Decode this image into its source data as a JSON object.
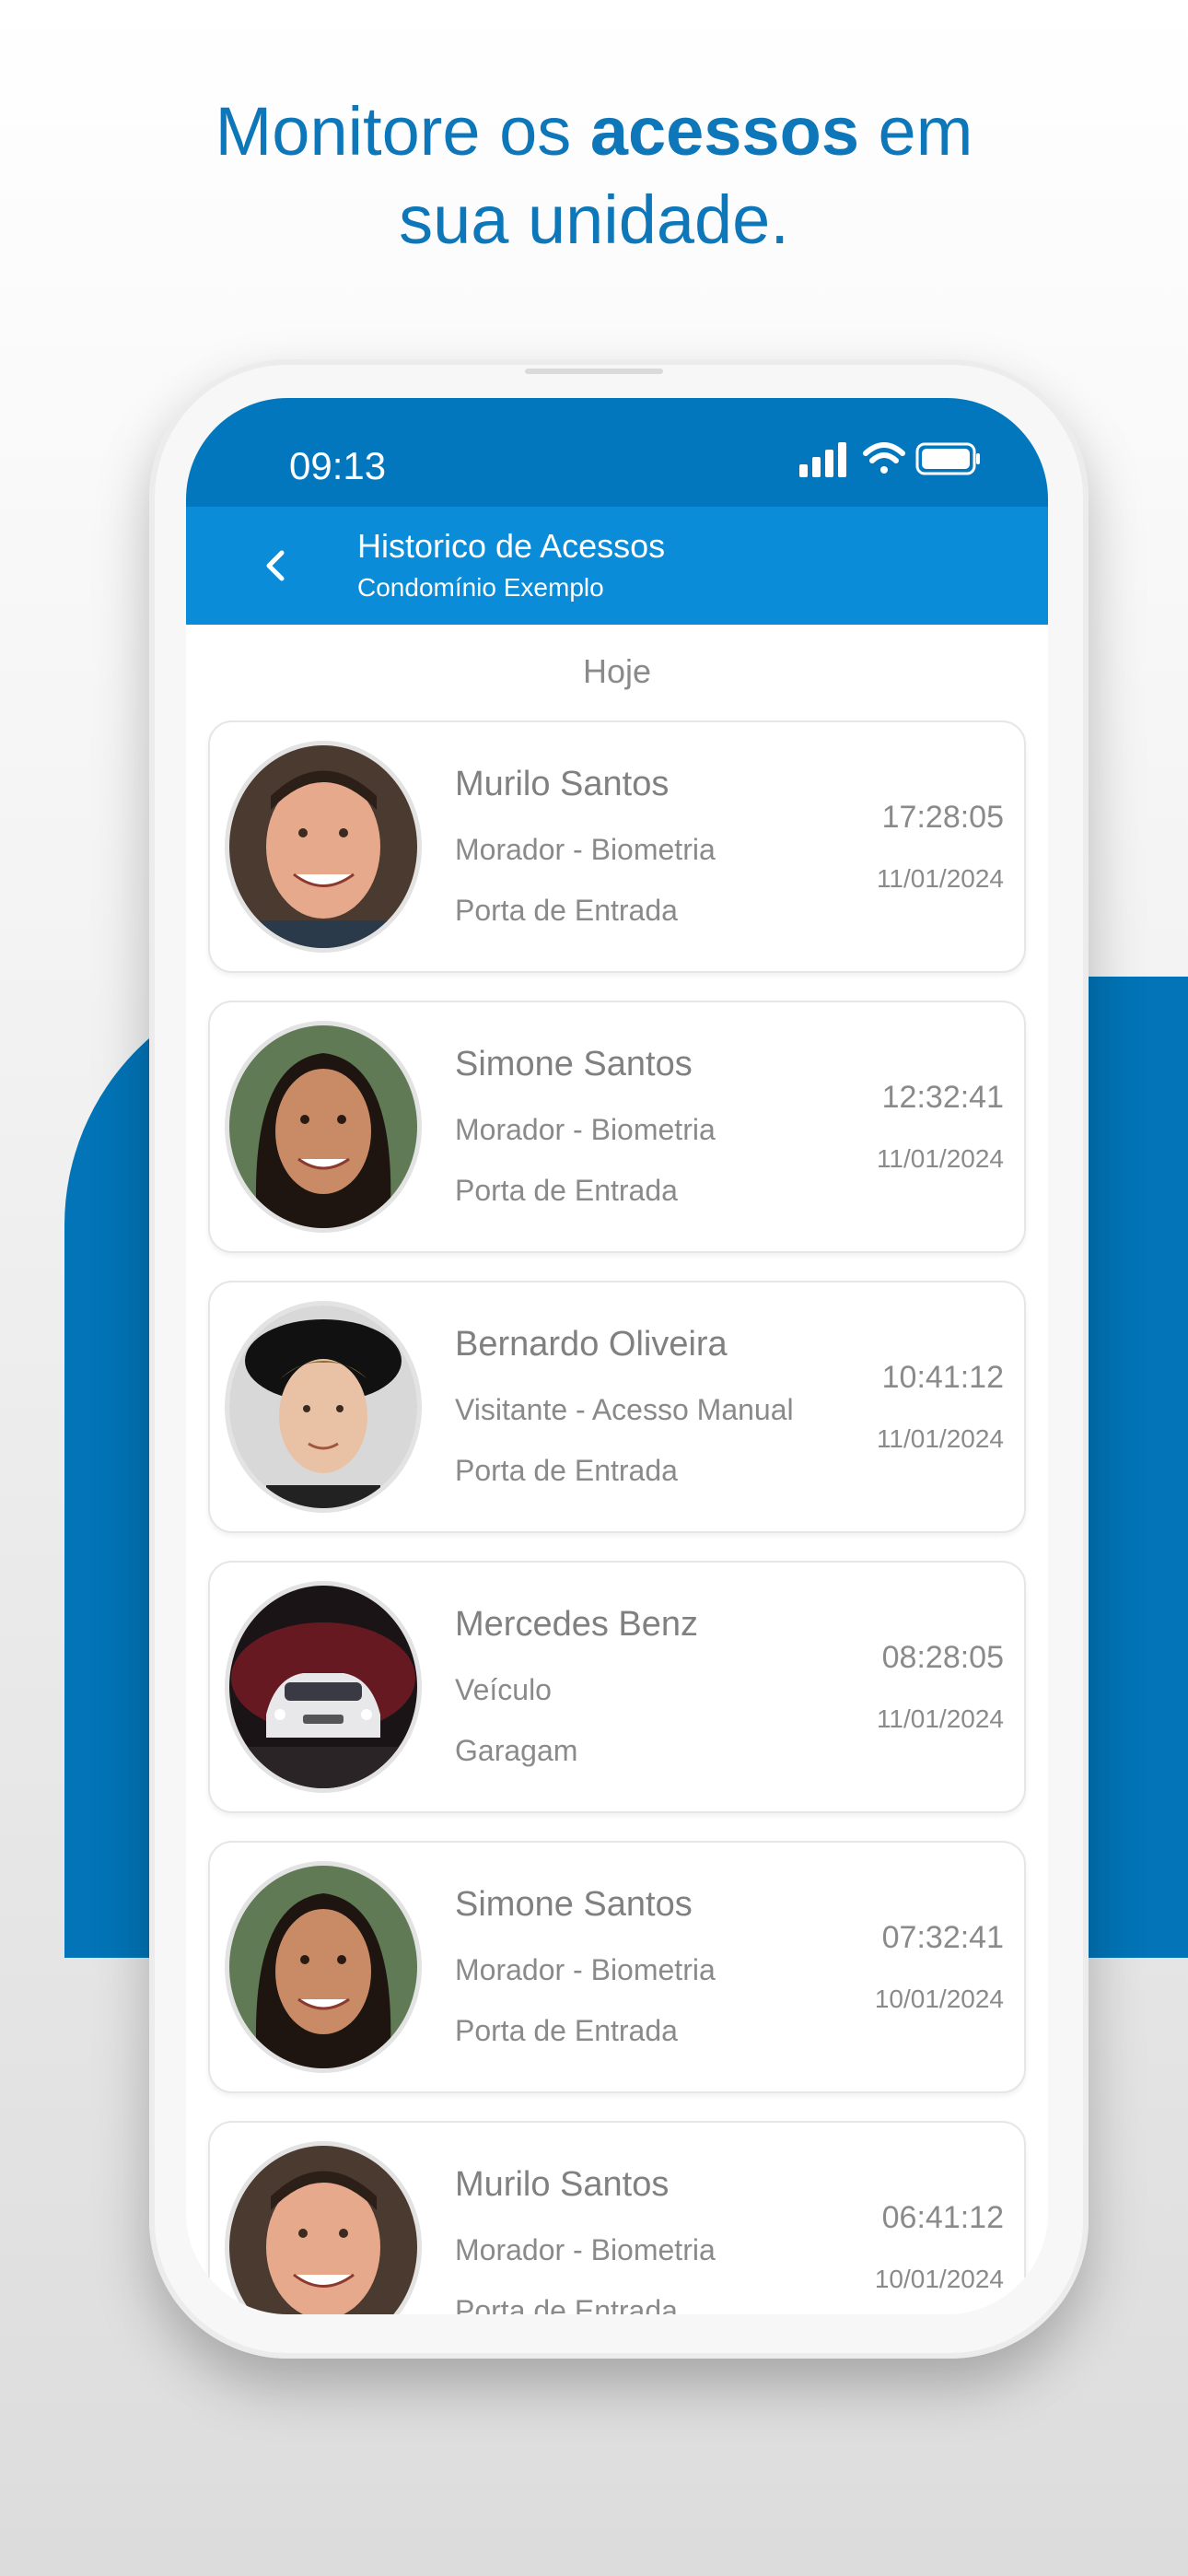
{
  "headline": {
    "part1": "Monitore os ",
    "bold": "acessos",
    "part2": " em",
    "line2": "sua unidade."
  },
  "status_bar": {
    "time": "09:13",
    "icons": [
      "signal-icon",
      "wifi-icon",
      "battery-icon"
    ]
  },
  "app_bar": {
    "title": "Historico de Acessos",
    "subtitle": "Condomínio Exemplo",
    "back_icon": "chevron-left-icon"
  },
  "section": "Hoje",
  "colors": {
    "brand_blue": "#0274b7",
    "app_bar": "#0a8cd9",
    "status_bar": "#0277bd",
    "headline": "#0d77b9"
  },
  "entries": [
    {
      "name": "Murilo Santos",
      "type": "Morador - Biometria",
      "door": "Porta de Entrada",
      "time": "17:28:05",
      "date": "11/01/2024",
      "avatar": "man-photo"
    },
    {
      "name": "Simone Santos",
      "type": "Morador - Biometria",
      "door": "Porta de Entrada",
      "time": "12:32:41",
      "date": "11/01/2024",
      "avatar": "woman-photo"
    },
    {
      "name": "Bernardo Oliveira",
      "type": "Visitante - Acesso Manual",
      "door": "Porta de Entrada",
      "time": "10:41:12",
      "date": "11/01/2024",
      "avatar": "visitor-photo"
    },
    {
      "name": "Mercedes Benz",
      "type": "Veículo",
      "door": "Garagam",
      "time": "08:28:05",
      "date": "11/01/2024",
      "avatar": "car-photo"
    },
    {
      "name": "Simone Santos",
      "type": "Morador - Biometria",
      "door": "Porta de Entrada",
      "time": "07:32:41",
      "date": "10/01/2024",
      "avatar": "woman-photo"
    },
    {
      "name": "Murilo Santos",
      "type": "Morador - Biometria",
      "door": "Porta de Entrada",
      "time": "06:41:12",
      "date": "10/01/2024",
      "avatar": "man-photo"
    }
  ]
}
